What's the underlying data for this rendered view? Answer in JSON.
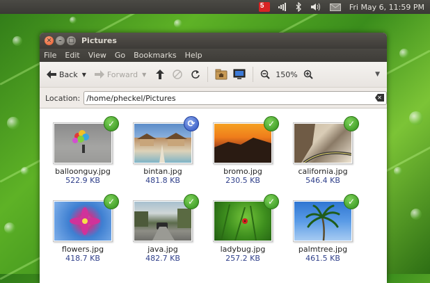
{
  "panel": {
    "network_badge": "5",
    "clock": "Fri May  6, 11:59 PM"
  },
  "window": {
    "title": "Pictures",
    "menu": [
      "File",
      "Edit",
      "View",
      "Go",
      "Bookmarks",
      "Help"
    ],
    "toolbar": {
      "back_label": "Back",
      "forward_label": "Forward",
      "zoom_level": "150%"
    },
    "location": {
      "label": "Location:",
      "path": "/home/pheckel/Pictures"
    }
  },
  "files": [
    {
      "name": "balloonguy.jpg",
      "size": "522.9 KB",
      "emblem": "check-icon"
    },
    {
      "name": "bintan.jpg",
      "size": "481.8 KB",
      "emblem": "sync-icon"
    },
    {
      "name": "bromo.jpg",
      "size": "230.5 KB",
      "emblem": "check-icon"
    },
    {
      "name": "california.jpg",
      "size": "546.4 KB",
      "emblem": "check-icon"
    },
    {
      "name": "flowers.jpg",
      "size": "418.7 KB",
      "emblem": "check-icon"
    },
    {
      "name": "java.jpg",
      "size": "482.7 KB",
      "emblem": "check-icon"
    },
    {
      "name": "ladybug.jpg",
      "size": "257.2 KB",
      "emblem": "check-icon"
    },
    {
      "name": "palmtree.jpg",
      "size": "461.5 KB",
      "emblem": "check-icon"
    }
  ],
  "colors": {
    "check_emblem": "#2e8d1a",
    "sync_emblem": "#2a4fbf",
    "file_size_text": "#2f3f8a"
  }
}
